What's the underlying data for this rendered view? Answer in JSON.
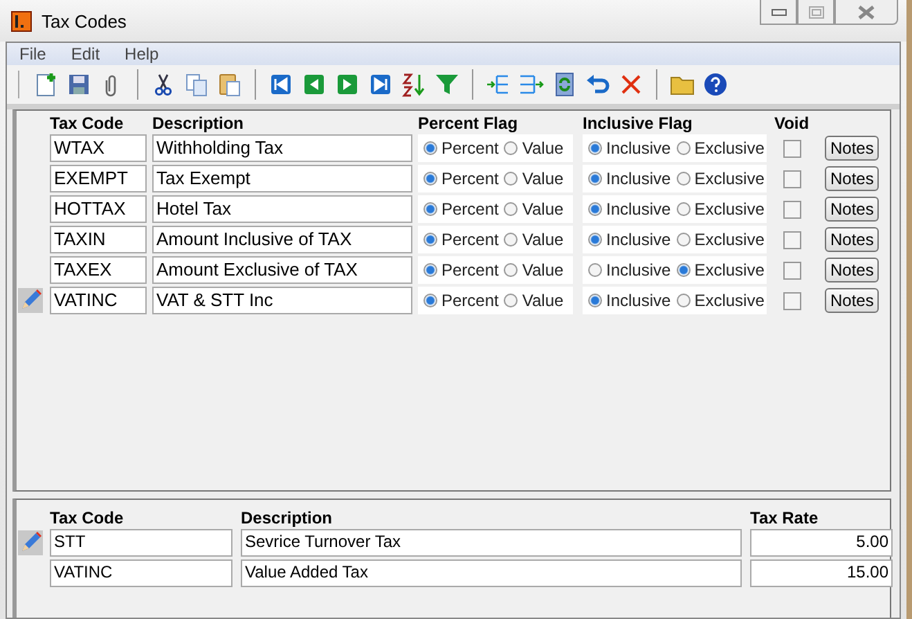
{
  "window": {
    "title": "Tax Codes"
  },
  "menu": [
    "File",
    "Edit",
    "Help"
  ],
  "toolbar": [
    {
      "kind": "new"
    },
    {
      "kind": "save"
    },
    {
      "kind": "attach"
    },
    {
      "kind": "sep"
    },
    {
      "kind": "cut"
    },
    {
      "kind": "copy"
    },
    {
      "kind": "paste"
    },
    {
      "kind": "sep"
    },
    {
      "kind": "first"
    },
    {
      "kind": "prev"
    },
    {
      "kind": "next"
    },
    {
      "kind": "last"
    },
    {
      "kind": "sort"
    },
    {
      "kind": "filter"
    },
    {
      "kind": "sep"
    },
    {
      "kind": "indent"
    },
    {
      "kind": "outdent"
    },
    {
      "kind": "refresh"
    },
    {
      "kind": "undo"
    },
    {
      "kind": "delete"
    },
    {
      "kind": "sep"
    },
    {
      "kind": "folder"
    },
    {
      "kind": "help"
    }
  ],
  "tax_codes": {
    "columns": [
      "Tax Code",
      "Description",
      "Percent Flag",
      "Inclusive Flag",
      "Void"
    ],
    "rows": [
      {
        "code": "WTAX",
        "description": "Withholding Tax",
        "percent_flag": [
          {
            "label": "Percent",
            "selected": true
          },
          {
            "label": "Value",
            "selected": false
          }
        ],
        "inclusive_flag": [
          {
            "label": "Inclusive",
            "selected": true
          },
          {
            "label": "Exclusive",
            "selected": false
          }
        ],
        "void": false,
        "notes": "Notes",
        "editing": false
      },
      {
        "code": "EXEMPT",
        "description": "Tax Exempt",
        "percent_flag": [
          {
            "label": "Percent",
            "selected": true
          },
          {
            "label": "Value",
            "selected": false
          }
        ],
        "inclusive_flag": [
          {
            "label": "Inclusive",
            "selected": true
          },
          {
            "label": "Exclusive",
            "selected": false
          }
        ],
        "void": false,
        "notes": "Notes",
        "editing": false
      },
      {
        "code": "HOTTAX",
        "description": "Hotel Tax",
        "percent_flag": [
          {
            "label": "Percent",
            "selected": true
          },
          {
            "label": "Value",
            "selected": false
          }
        ],
        "inclusive_flag": [
          {
            "label": "Inclusive",
            "selected": true
          },
          {
            "label": "Exclusive",
            "selected": false
          }
        ],
        "void": false,
        "notes": "Notes",
        "editing": false
      },
      {
        "code": "TAXIN",
        "description": "Amount Inclusive of TAX",
        "percent_flag": [
          {
            "label": "Percent",
            "selected": true
          },
          {
            "label": "Value",
            "selected": false
          }
        ],
        "inclusive_flag": [
          {
            "label": "Inclusive",
            "selected": true
          },
          {
            "label": "Exclusive",
            "selected": false
          }
        ],
        "void": false,
        "notes": "Notes",
        "editing": false
      },
      {
        "code": "TAXEX",
        "description": "Amount Exclusive of TAX",
        "percent_flag": [
          {
            "label": "Percent",
            "selected": true
          },
          {
            "label": "Value",
            "selected": false
          }
        ],
        "inclusive_flag": [
          {
            "label": "Inclusive",
            "selected": false
          },
          {
            "label": "Exclusive",
            "selected": true
          }
        ],
        "void": false,
        "notes": "Notes",
        "editing": false
      },
      {
        "code": "VATINC",
        "description": "VAT & STT Inc",
        "percent_flag": [
          {
            "label": "Percent",
            "selected": true
          },
          {
            "label": "Value",
            "selected": false
          }
        ],
        "inclusive_flag": [
          {
            "label": "Inclusive",
            "selected": true
          },
          {
            "label": "Exclusive",
            "selected": false
          }
        ],
        "void": false,
        "notes": "Notes",
        "editing": true
      }
    ]
  },
  "components": {
    "columns": [
      "Tax Code",
      "Description",
      "Tax Rate"
    ],
    "rows": [
      {
        "code": "STT",
        "description": "Sevrice Turnover Tax",
        "rate": "5.00",
        "editing": true
      },
      {
        "code": "VATINC",
        "description": "Value Added Tax",
        "rate": "15.00",
        "editing": false
      }
    ]
  }
}
